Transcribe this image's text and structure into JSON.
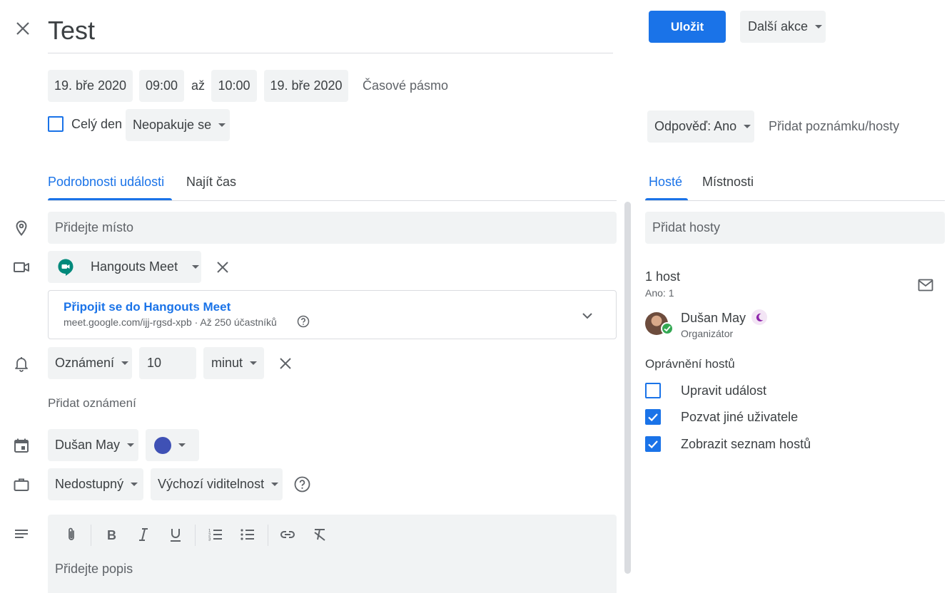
{
  "header": {
    "title": "Test",
    "save_label": "Uložit",
    "more_actions_label": "Další akce"
  },
  "datetime": {
    "start_date": "19. bře 2020",
    "start_time": "09:00",
    "to_label": "až",
    "end_time": "10:00",
    "end_date": "19. bře 2020",
    "timezone_label": "Časové pásmo",
    "all_day_label": "Celý den",
    "recurrence": "Neopakuje se"
  },
  "rsvp": {
    "label": "Odpověď: Ano",
    "add_note_label": "Přidat poznámku/hosty"
  },
  "tabs": {
    "details": "Podrobnosti události",
    "find_time": "Najít čas",
    "guests": "Hosté",
    "rooms": "Místnosti"
  },
  "details": {
    "location_placeholder": "Přidejte místo",
    "conference": "Hangouts Meet",
    "join_label": "Připojit se do Hangouts Meet",
    "join_info": "meet.google.com/ijj-rgsd-xpb · Až 250 účastníků",
    "notification_type": "Oznámení",
    "notification_value": "10",
    "notification_unit": "minut",
    "add_notification": "Přidat oznámení",
    "calendar_owner": "Dušan May",
    "availability": "Nedostupný",
    "visibility": "Výchozí viditelnost",
    "description_placeholder": "Přidejte popis"
  },
  "guests": {
    "add_placeholder": "Přidat hosty",
    "count": "1 host",
    "yes_count": "Ano: 1",
    "list": [
      {
        "name": "Dušan May",
        "role": "Organizátor"
      }
    ],
    "permissions_title": "Oprávnění hostů",
    "permissions": [
      {
        "label": "Upravit událost",
        "checked": false
      },
      {
        "label": "Pozvat jiné uživatele",
        "checked": true
      },
      {
        "label": "Zobrazit seznam hostů",
        "checked": true
      }
    ]
  },
  "colors": {
    "accent": "#1a73e8",
    "calendar_color": "#3f51b5",
    "meet_green": "#00897b"
  }
}
